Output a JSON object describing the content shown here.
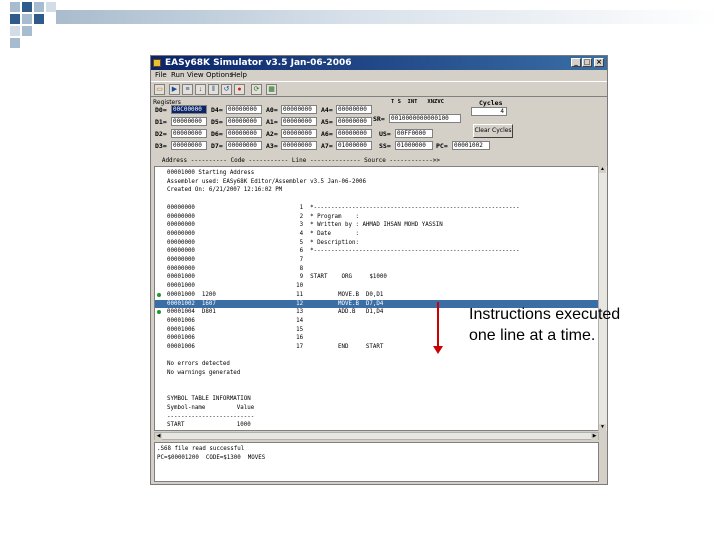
{
  "window": {
    "title": "EASy68K Simulator v3.5 Jan-06-2006",
    "menu": [
      "File",
      "Run",
      "View",
      "Options",
      "Help"
    ]
  },
  "registers": {
    "group_label": "Registers",
    "rows": [
      {
        "d_label": "D0=",
        "d_value": "00C00000",
        "d2_label": "D4=",
        "d2_value": "00000000",
        "a_label": "A0=",
        "a_value": "00000000",
        "a2_label": "A4=",
        "a2_value": "00000000"
      },
      {
        "d_label": "D1=",
        "d_value": "00000000",
        "d2_label": "D5=",
        "d2_value": "00000000",
        "a_label": "A1=",
        "a_value": "00000000",
        "a2_label": "A5=",
        "a2_value": "00000000"
      },
      {
        "d_label": "D2=",
        "d_value": "00000000",
        "d2_label": "D6=",
        "d2_value": "00000000",
        "a_label": "A2=",
        "a_value": "00000000",
        "a2_label": "A6=",
        "a2_value": "00000000"
      },
      {
        "d_label": "D3=",
        "d_value": "00000000",
        "d2_label": "D7=",
        "d2_value": "00000000",
        "a_label": "A3=",
        "a_value": "00000000",
        "a2_label": "A7=",
        "a2_value": "01000000"
      }
    ],
    "flags_header": "T S  INT   XNZVC",
    "sr_label": "SR=",
    "sr_value": "0010000000000100",
    "us_label": "US=",
    "us_value": "00FF0000",
    "ss_label": "SS=",
    "ss_value": "01000000",
    "pc_label": "PC=",
    "pc_value": "00001002",
    "cycles_label": "Cycles",
    "cycles_value": "4",
    "clear_cycles": "Clear Cycles"
  },
  "column_header": "   Address ---------- Code ----------- Line -------------- Source ------------>>",
  "listing": [
    {
      "text": "00001000 Starting Address",
      "hl": false,
      "bp": false
    },
    {
      "text": "Assembler used: EASy68K Editor/Assembler v3.5 Jan-06-2006",
      "hl": false,
      "bp": false
    },
    {
      "text": "Created On: 6/21/2007 12:16:02 PM",
      "hl": false,
      "bp": false
    },
    {
      "text": "",
      "hl": false,
      "bp": false
    },
    {
      "text": "00000000                              1  *-----------------------------------------------------------",
      "hl": false,
      "bp": false
    },
    {
      "text": "00000000                              2  * Program    :",
      "hl": false,
      "bp": false
    },
    {
      "text": "00000000                              3  * Written by : AHMAD IHSAN MOHD YASSIN",
      "hl": false,
      "bp": false
    },
    {
      "text": "00000000                              4  * Date       :",
      "hl": false,
      "bp": false
    },
    {
      "text": "00000000                              5  * Description:",
      "hl": false,
      "bp": false
    },
    {
      "text": "00000000                              6  *-----------------------------------------------------------",
      "hl": false,
      "bp": false
    },
    {
      "text": "00000000                              7",
      "hl": false,
      "bp": false
    },
    {
      "text": "00000000                              8",
      "hl": false,
      "bp": false
    },
    {
      "text": "00001000                              9  START    ORG     $1000",
      "hl": false,
      "bp": false
    },
    {
      "text": "00001000                             10",
      "hl": false,
      "bp": false
    },
    {
      "text": "00001000  1200                       11          MOVE.B  D0,D1",
      "hl": false,
      "bp": true
    },
    {
      "text": "00001002  1607                       12          MOVE.B  D7,D4",
      "hl": true,
      "bp": true
    },
    {
      "text": "00001004  D801                       13          ADD.B   D1,D4",
      "hl": false,
      "bp": true
    },
    {
      "text": "00001006                             14",
      "hl": false,
      "bp": false
    },
    {
      "text": "00001006                             15",
      "hl": false,
      "bp": false
    },
    {
      "text": "00001006                             16",
      "hl": false,
      "bp": false
    },
    {
      "text": "00001006                             17          END     START",
      "hl": false,
      "bp": false
    },
    {
      "text": "",
      "hl": false,
      "bp": false
    },
    {
      "text": "No errors detected",
      "hl": false,
      "bp": false
    },
    {
      "text": "No warnings generated",
      "hl": false,
      "bp": false
    },
    {
      "text": "",
      "hl": false,
      "bp": false
    },
    {
      "text": "",
      "hl": false,
      "bp": false
    },
    {
      "text": "SYMBOL TABLE INFORMATION",
      "hl": false,
      "bp": false
    },
    {
      "text": "Symbol-name         Value",
      "hl": false,
      "bp": false
    },
    {
      "text": "-------------------------",
      "hl": false,
      "bp": false
    },
    {
      "text": "START               1000",
      "hl": false,
      "bp": false
    }
  ],
  "output": [
    ".S68 file read successful",
    "PC=$00001200  CODE=$1300  MOVES"
  ],
  "annotation": {
    "line1": "Instructions executed",
    "line2": "one line at a time."
  },
  "colors": {
    "arrow": "#cc0000",
    "highlight": "#3a6ea5",
    "breakpoint": "#1e9a28"
  }
}
